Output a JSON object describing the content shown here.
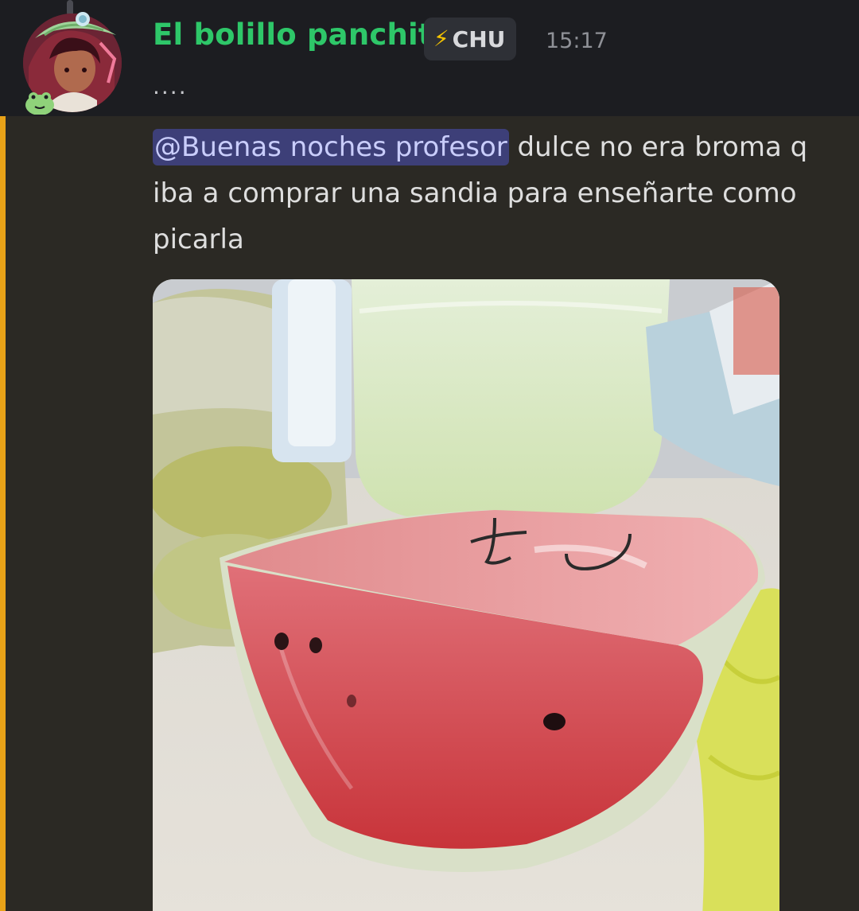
{
  "message": {
    "author": "El bolillo panchito",
    "tag": {
      "icon": "lightning-bolt-icon",
      "icon_glyph": "⚡",
      "label": "CHU"
    },
    "timestamp": "15:17",
    "preview": "....",
    "mention": "@Buenas noches profesor",
    "text": " dulce no era broma q iba a comprar una sandia para enseñarte como picarla",
    "attachment": {
      "handwritten_text": "tú"
    }
  },
  "colors": {
    "username": "#2ec769",
    "highlight_bar": "#e8a218",
    "mention_bg": "#3d3f78",
    "mention_text": "#c9cdfb",
    "background": "#2b2924",
    "header_background": "#1c1d21"
  }
}
